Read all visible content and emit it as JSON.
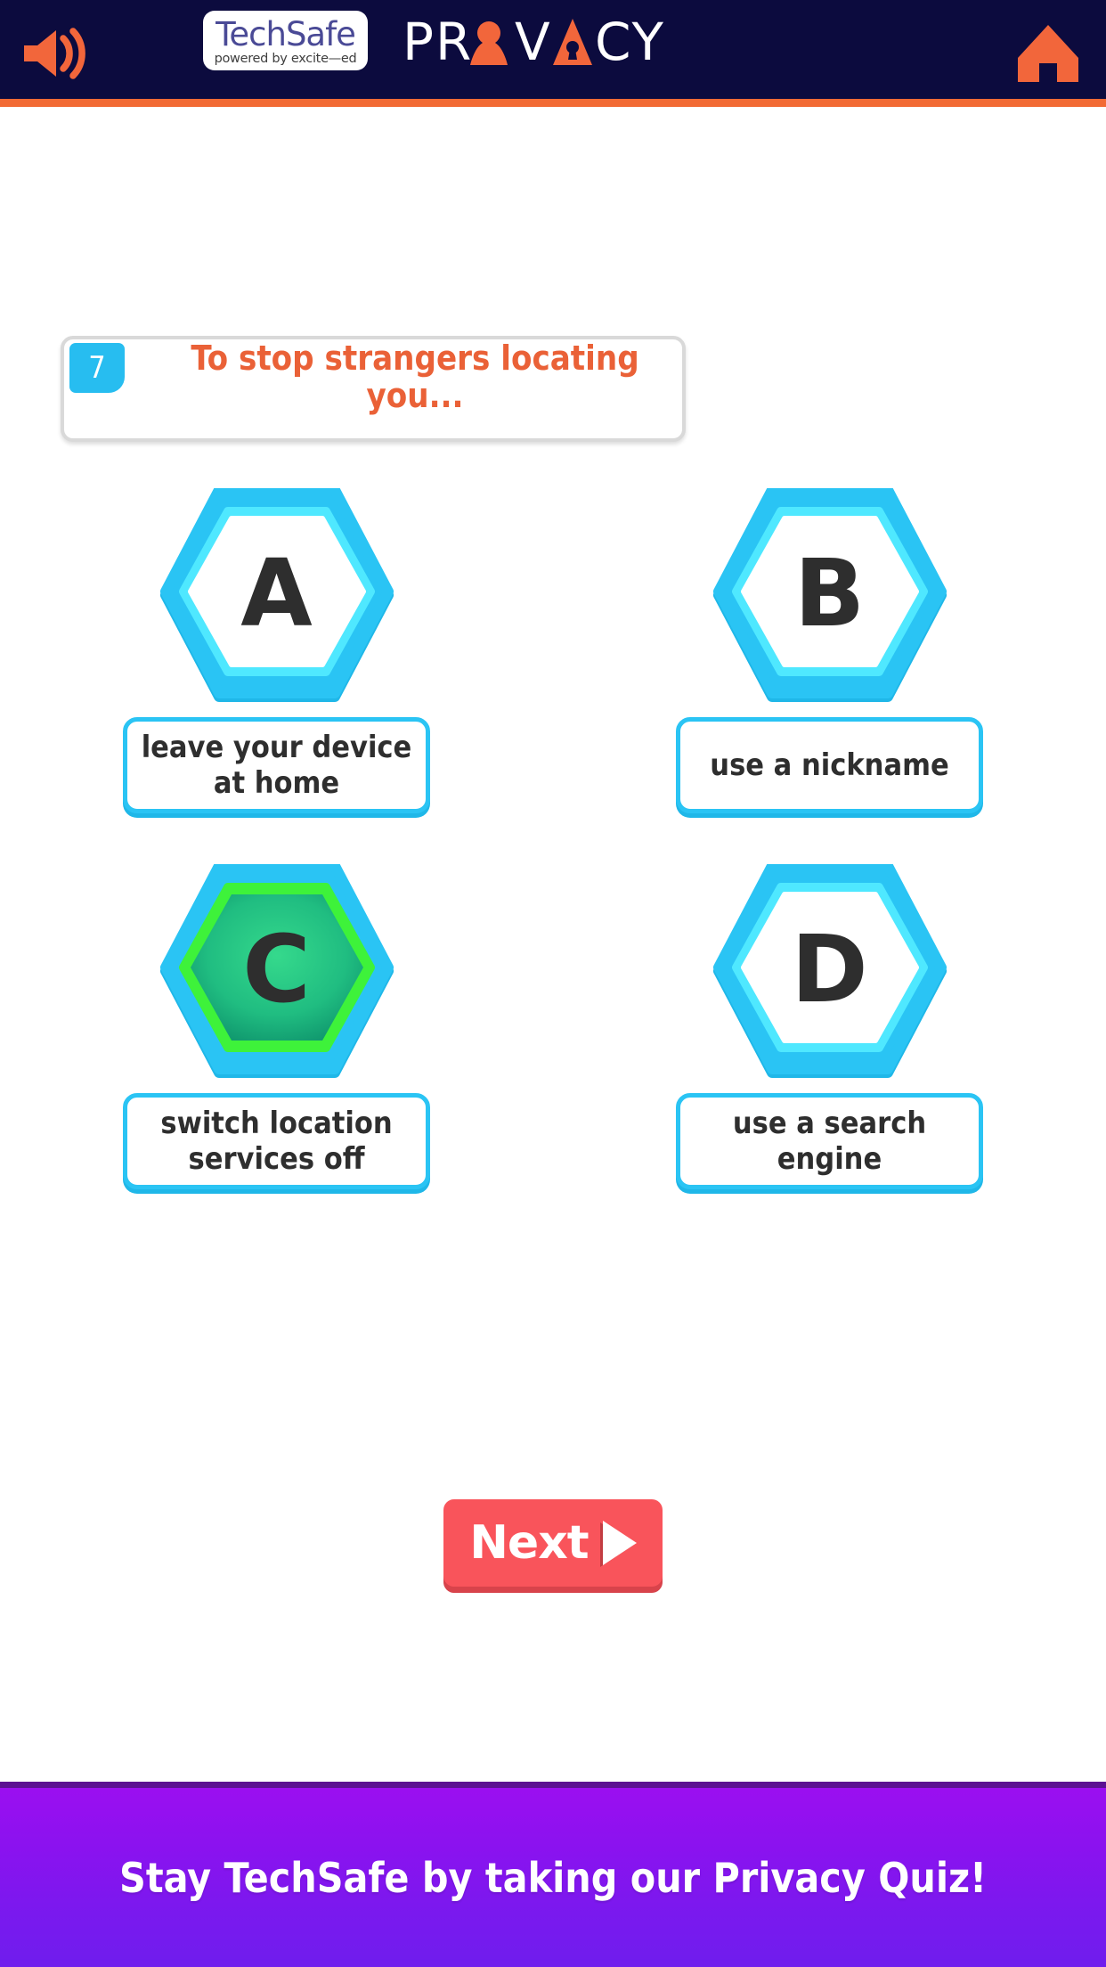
{
  "header": {
    "background_color": "#0c0b3e",
    "accent_color": "#f26a34",
    "speaker_icon": "speaker-volume-icon",
    "home_icon": "home-icon",
    "logo": {
      "main": "TechSafe",
      "sub": "powered by excite—ed",
      "text_color": "#4a4a96"
    },
    "title": "PRIVACY"
  },
  "question": {
    "number": "7",
    "number_badge_color": "#27bdf0",
    "text": "To stop strangers locating you...",
    "text_color": "#ea6137"
  },
  "answers": [
    {
      "letter": "A",
      "label": "leave your device at home",
      "selected": false,
      "hex_color": "#2ac4f4"
    },
    {
      "letter": "B",
      "label": "use a nickname",
      "selected": false,
      "hex_color": "#2ac4f4"
    },
    {
      "letter": "C",
      "label": "switch location services off",
      "selected": true,
      "hex_color": "#2ac4f4",
      "selected_ring_color": "#3ef23a",
      "selected_fill_color": "#1fb877"
    },
    {
      "letter": "D",
      "label": "use a search engine",
      "selected": false,
      "hex_color": "#2ac4f4"
    }
  ],
  "next_button": {
    "label": "Next",
    "icon": "play-triangle-icon",
    "color": "#f9545b"
  },
  "footer": {
    "text": "Stay TechSafe by taking our Privacy Quiz!",
    "color": "#8b12ef"
  }
}
